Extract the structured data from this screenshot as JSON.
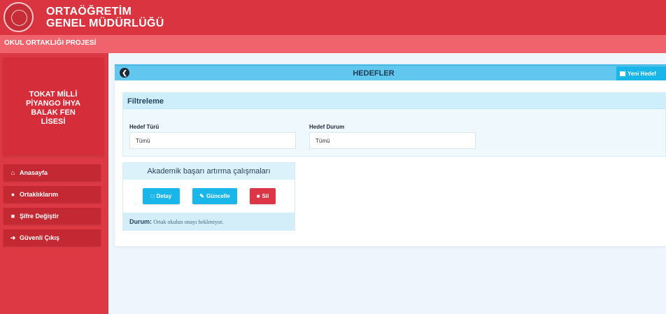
{
  "header": {
    "brand_line1": "ORTAÖĞRETİM",
    "brand_line2": "GENEL MÜDÜRLÜĞÜ"
  },
  "subheader": {
    "project": "OKUL ORTAKLIĞI PROJESİ"
  },
  "sidebar": {
    "school_line1": "TOKAT MİLLİ",
    "school_line2": "PİYANGO İHYA",
    "school_line3": "BALAK FEN",
    "school_line4": "LİSESİ",
    "items": [
      {
        "label": "Anasayfa",
        "icon": "home-icon"
      },
      {
        "label": "Ortaklıklarım",
        "icon": "handshake-icon"
      },
      {
        "label": "Şifre Değiştir",
        "icon": "lock-icon"
      },
      {
        "label": "Güvenli Çıkış",
        "icon": "sign-out-icon"
      }
    ]
  },
  "main": {
    "title": "HEDEFLER",
    "new_button": "Yeni Hedef",
    "filter": {
      "title": "Filtreleme",
      "type_label": "Hedef Türü",
      "type_value": "Tümü",
      "status_label": "Hedef Durum",
      "status_value": "Tümü"
    },
    "goal": {
      "title": "Akademik başarı artırma çalışmaları",
      "detail_button": "Detay",
      "update_button": "Güncelle",
      "delete_button": "Sil",
      "status_label": "Durum:",
      "status_value": "Ortak okulun onayı bekleniyor."
    }
  },
  "colors": {
    "topbar": "#d9343f",
    "subbar": "#f0636d",
    "sidebar": "#dd3944",
    "header_blue": "#62c7ee",
    "button_blue": "#19b6ea",
    "button_red": "#dc3545"
  }
}
